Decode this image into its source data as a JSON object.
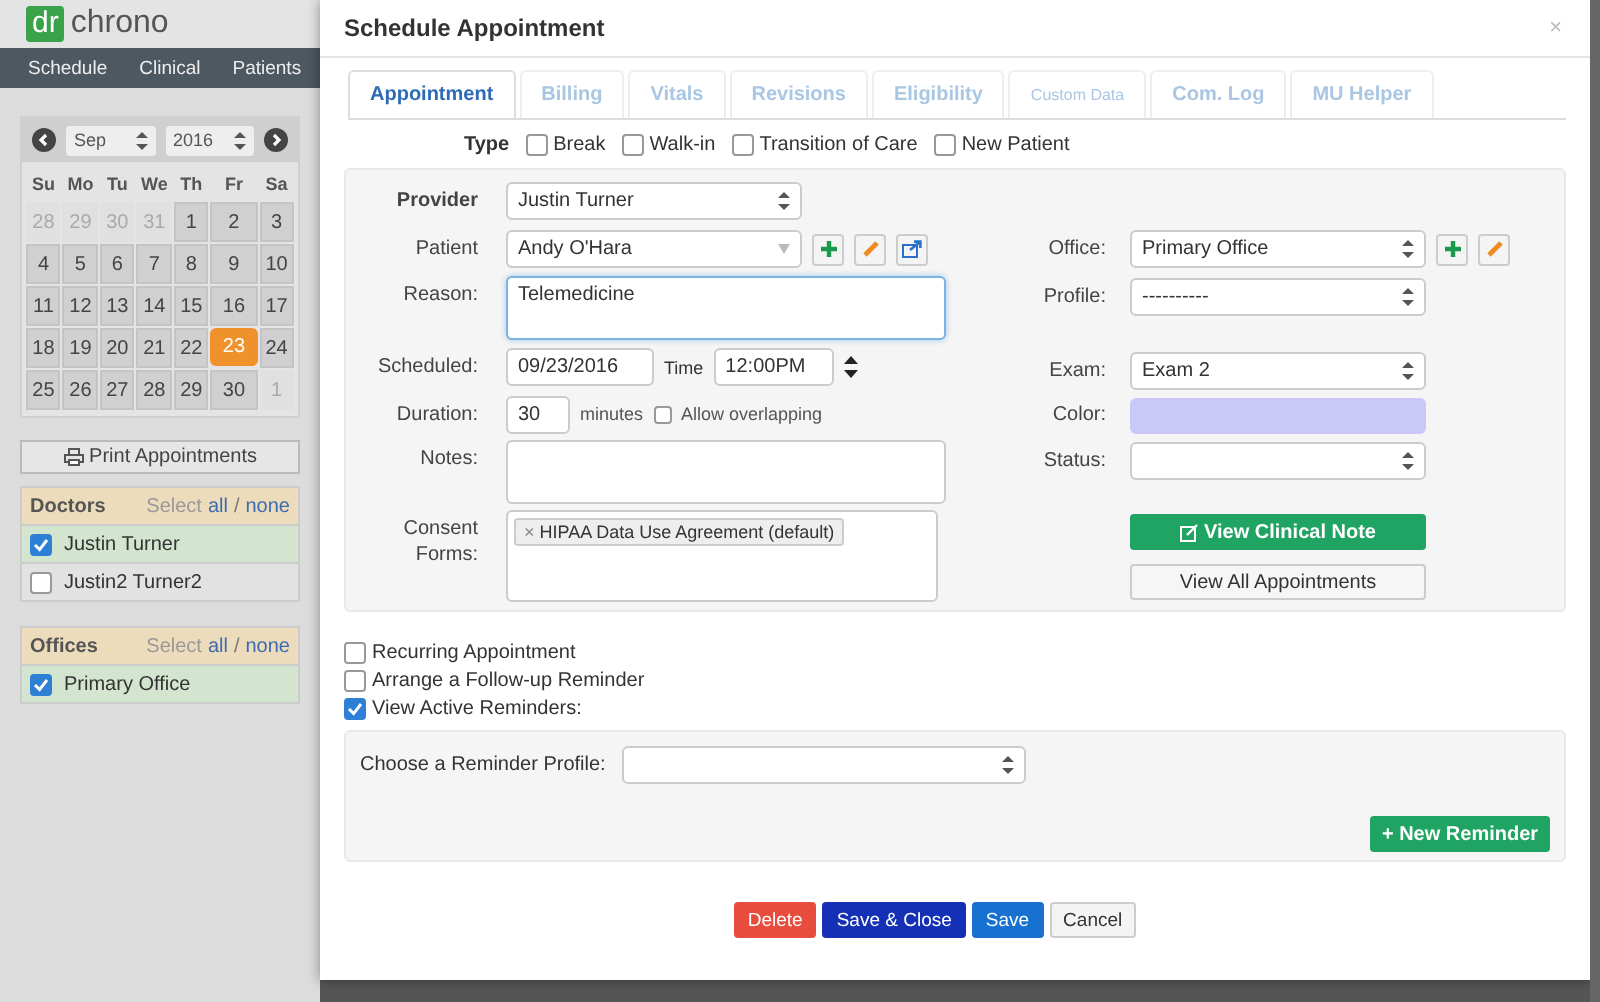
{
  "app": {
    "logo_mark": "dr",
    "logo_text": "chrono",
    "nav": [
      "Schedule",
      "Clinical",
      "Patients"
    ]
  },
  "calendar": {
    "month": "Sep",
    "year": "2016",
    "weekdays": [
      "Su",
      "Mo",
      "Tu",
      "We",
      "Th",
      "Fr",
      "Sa"
    ],
    "weeks": [
      [
        {
          "day": "28",
          "muted": true,
          "selected": false
        },
        {
          "day": "29",
          "muted": true,
          "selected": false
        },
        {
          "day": "30",
          "muted": true,
          "selected": false
        },
        {
          "day": "31",
          "muted": true,
          "selected": false
        },
        {
          "day": "1",
          "muted": false,
          "selected": false
        },
        {
          "day": "2",
          "muted": false,
          "selected": false
        },
        {
          "day": "3",
          "muted": false,
          "selected": false
        }
      ],
      [
        {
          "day": "4",
          "muted": false,
          "selected": false
        },
        {
          "day": "5",
          "muted": false,
          "selected": false
        },
        {
          "day": "6",
          "muted": false,
          "selected": false
        },
        {
          "day": "7",
          "muted": false,
          "selected": false
        },
        {
          "day": "8",
          "muted": false,
          "selected": false
        },
        {
          "day": "9",
          "muted": false,
          "selected": false
        },
        {
          "day": "10",
          "muted": false,
          "selected": false
        }
      ],
      [
        {
          "day": "11",
          "muted": false,
          "selected": false
        },
        {
          "day": "12",
          "muted": false,
          "selected": false
        },
        {
          "day": "13",
          "muted": false,
          "selected": false
        },
        {
          "day": "14",
          "muted": false,
          "selected": false
        },
        {
          "day": "15",
          "muted": false,
          "selected": false
        },
        {
          "day": "16",
          "muted": false,
          "selected": false
        },
        {
          "day": "17",
          "muted": false,
          "selected": false
        }
      ],
      [
        {
          "day": "18",
          "muted": false,
          "selected": false
        },
        {
          "day": "19",
          "muted": false,
          "selected": false
        },
        {
          "day": "20",
          "muted": false,
          "selected": false
        },
        {
          "day": "21",
          "muted": false,
          "selected": false
        },
        {
          "day": "22",
          "muted": false,
          "selected": false
        },
        {
          "day": "23",
          "muted": false,
          "selected": true
        },
        {
          "day": "24",
          "muted": false,
          "selected": false
        }
      ],
      [
        {
          "day": "25",
          "muted": false,
          "selected": false
        },
        {
          "day": "26",
          "muted": false,
          "selected": false
        },
        {
          "day": "27",
          "muted": false,
          "selected": false
        },
        {
          "day": "28",
          "muted": false,
          "selected": false
        },
        {
          "day": "29",
          "muted": false,
          "selected": false
        },
        {
          "day": "30",
          "muted": false,
          "selected": false
        },
        {
          "day": "1",
          "muted": true,
          "selected": false
        }
      ]
    ]
  },
  "print_button": "Print Appointments",
  "panels": [
    {
      "title": "Doctors",
      "select": "Select",
      "all": "all",
      "sep": "/",
      "none": "none",
      "items": [
        {
          "name": "Justin Turner",
          "checked": true
        },
        {
          "name": "Justin2 Turner2",
          "checked": false
        }
      ]
    },
    {
      "title": "Offices",
      "select": "Select",
      "all": "all",
      "sep": "/",
      "none": "none",
      "items": [
        {
          "name": "Primary Office",
          "checked": true
        }
      ]
    }
  ],
  "modal": {
    "title": "Schedule Appointment",
    "close": "×",
    "tabs": [
      {
        "label": "Appointment",
        "selected": true
      },
      {
        "label": "Billing",
        "selected": false
      },
      {
        "label": "Vitals",
        "selected": false
      },
      {
        "label": "Revisions",
        "selected": false
      },
      {
        "label": "Eligibility",
        "selected": false
      },
      {
        "label": "Custom Data",
        "selected": false
      },
      {
        "label": "Com. Log",
        "selected": false
      },
      {
        "label": "MU Helper",
        "selected": false
      }
    ],
    "type_label": "Type",
    "types": [
      {
        "label": "Break",
        "checked": false
      },
      {
        "label": "Walk-in",
        "checked": false
      },
      {
        "label": "Transition of Care",
        "checked": false
      },
      {
        "label": "New Patient",
        "checked": false
      }
    ],
    "provider": {
      "label": "Provider",
      "value": "Justin Turner"
    },
    "patient": {
      "label": "Patient",
      "value": "Andy O'Hara"
    },
    "reason": {
      "label": "Reason:",
      "value": "Telemedicine"
    },
    "scheduled": {
      "label": "Scheduled:",
      "date": "09/23/2016",
      "time_label": "Time",
      "time": "12:00PM"
    },
    "duration": {
      "label": "Duration:",
      "value": "30",
      "unit": "minutes",
      "overlap_label": "Allow overlapping",
      "overlap": false
    },
    "notes": {
      "label": "Notes:"
    },
    "consent": {
      "label": "Consent Forms:",
      "remove": "×",
      "tags": [
        "HIPAA Data Use Agreement (default)"
      ]
    },
    "office": {
      "label": "Office:",
      "value": "Primary Office"
    },
    "profile": {
      "label": "Profile:",
      "value": "----------"
    },
    "exam": {
      "label": "Exam:",
      "value": "Exam 2"
    },
    "color": {
      "label": "Color:",
      "color": "#c9c8f7"
    },
    "status": {
      "label": "Status:"
    },
    "clinical_note_button": "View Clinical Note",
    "all_appointments_button": "View All Appointments",
    "options": [
      {
        "label": "Recurring Appointment",
        "checked": false
      },
      {
        "label": "Arrange a Follow-up Reminder",
        "checked": false
      },
      {
        "label": "View Active Reminders:",
        "checked": true
      }
    ],
    "reminder_label": "Choose a Reminder Profile:",
    "new_reminder_button": "+ New Reminder",
    "footer": [
      {
        "label": "Delete",
        "kind": "danger"
      },
      {
        "label": "Save & Close",
        "kind": "primary"
      },
      {
        "label": "Save",
        "kind": "info"
      },
      {
        "label": "Cancel",
        "kind": "default"
      }
    ]
  }
}
